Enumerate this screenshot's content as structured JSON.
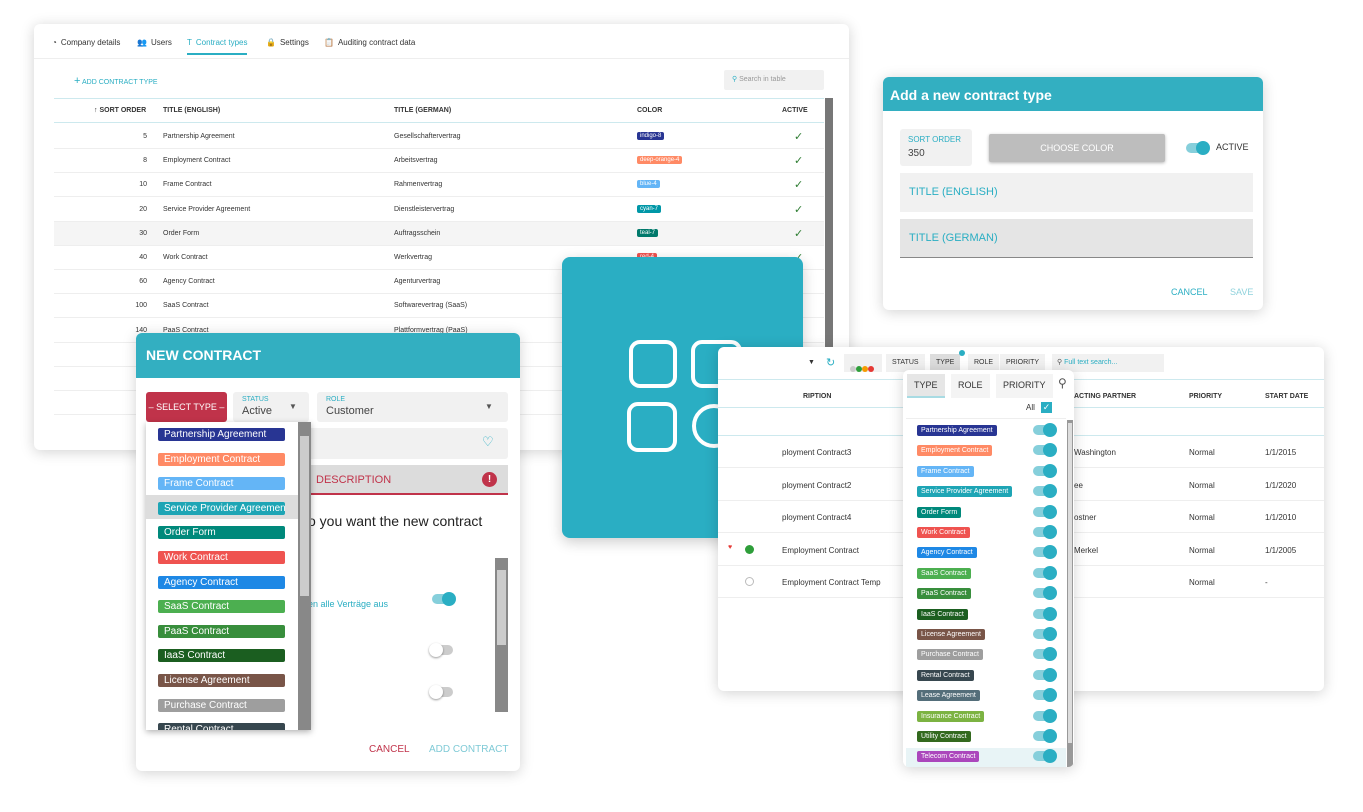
{
  "settings": {
    "tabs": [
      {
        "label": "Company details",
        "icon": "building-icon"
      },
      {
        "label": "Users",
        "icon": "users-icon"
      },
      {
        "label": "Contract types",
        "icon": "text-icon",
        "active": true
      },
      {
        "label": "Settings",
        "icon": "lock-icon"
      },
      {
        "label": "Auditing contract data",
        "icon": "clipboard-icon"
      }
    ],
    "add_label": "ADD CONTRACT TYPE",
    "search_placeholder": "Search in table",
    "columns": [
      "SORT ORDER",
      "TITLE (ENGLISH)",
      "TITLE (GERMAN)",
      "COLOR",
      "ACTIVE"
    ],
    "rows": [
      {
        "order": "5",
        "en": "Partnership Agreement",
        "de": "Gesellschaftervertrag",
        "color": "indigo-8",
        "hex": "#283593",
        "active": true
      },
      {
        "order": "8",
        "en": "Employment Contract",
        "de": "Arbeitsvertrag",
        "color": "deep-orange-4",
        "hex": "#ff8a65",
        "active": true
      },
      {
        "order": "10",
        "en": "Frame Contract",
        "de": "Rahmenvertrag",
        "color": "blue-4",
        "hex": "#64b5f6",
        "active": true
      },
      {
        "order": "20",
        "en": "Service Provider Agreement",
        "de": "Dienstleistervertrag",
        "color": "cyan-7",
        "hex": "#0097a7",
        "active": true
      },
      {
        "order": "30",
        "en": "Order Form",
        "de": "Auftragsschein",
        "color": "teal-7",
        "hex": "#00796b",
        "active": true
      },
      {
        "order": "40",
        "en": "Work Contract",
        "de": "Werkvertrag",
        "color": "red-4",
        "hex": "#ef5350",
        "active": true
      },
      {
        "order": "60",
        "en": "Agency Contract",
        "de": "Agenturvertrag",
        "color": "",
        "hex": "",
        "active": false
      },
      {
        "order": "100",
        "en": "SaaS Contract",
        "de": "Softwarevertrag (SaaS)",
        "color": "",
        "hex": "",
        "active": false
      },
      {
        "order": "140",
        "en": "PaaS Contract",
        "de": "Plattformvertrag (PaaS)",
        "color": "",
        "hex": "",
        "active": false
      }
    ]
  },
  "new_contract": {
    "title": "NEW CONTRACT",
    "select_type": "– SELECT TYPE –",
    "status_label": "STATUS",
    "status_value": "Active",
    "role_label": "ROLE",
    "role_value": "Customer",
    "description_label": "DESCRIPTION",
    "question": "o you want the new contract",
    "toggle_label": "en alle Verträge aus",
    "cancel": "CANCEL",
    "add": "ADD CONTRACT"
  },
  "types": [
    {
      "name": "Partnership Agreement",
      "hex": "#283593"
    },
    {
      "name": "Employment Contract",
      "hex": "#ff8a65"
    },
    {
      "name": "Frame Contract",
      "hex": "#64b5f6"
    },
    {
      "name": "Service Provider Agreement",
      "hex": "#1ea5b5"
    },
    {
      "name": "Order Form",
      "hex": "#00897b"
    },
    {
      "name": "Work Contract",
      "hex": "#ef5350"
    },
    {
      "name": "Agency Contract",
      "hex": "#1e88e5"
    },
    {
      "name": "SaaS Contract",
      "hex": "#4caf50"
    },
    {
      "name": "PaaS Contract",
      "hex": "#388e3c"
    },
    {
      "name": "IaaS Contract",
      "hex": "#1b5e20"
    },
    {
      "name": "License Agreement",
      "hex": "#795548"
    },
    {
      "name": "Purchase Contract",
      "hex": "#9e9e9e"
    },
    {
      "name": "Rental Contract",
      "hex": "#37474f"
    },
    {
      "name": "Lease Agreement",
      "hex": "#546e7a"
    },
    {
      "name": "Insurance Contract",
      "hex": "#7cb342"
    },
    {
      "name": "Utility Contract",
      "hex": "#33691e"
    },
    {
      "name": "Telecom Contract",
      "hex": "#ab47bc"
    }
  ],
  "add_type": {
    "title": "Add a new contract type",
    "sort_label": "SORT ORDER",
    "sort_value": "350",
    "choose_color": "CHOOSE COLOR",
    "active_label": "ACTIVE",
    "title_en": "TITLE (ENGLISH)",
    "title_de": "TITLE (GERMAN)",
    "cancel": "CANCEL",
    "save": "SAVE"
  },
  "contracts": {
    "filters": [
      "STATUS",
      "TYPE",
      "ROLE",
      "PRIORITY"
    ],
    "search_placeholder": "Full text search...",
    "columns": [
      "RIPTION",
      "ACTING PARTNER",
      "PRIORITY",
      "START DATE"
    ],
    "rows": [
      {
        "desc": "ployment Contract3",
        "partner": "Washington",
        "priority": "Normal",
        "start": "1/1/2015"
      },
      {
        "desc": "ployment Contract2",
        "partner": "ee",
        "priority": "Normal",
        "start": "1/1/2020"
      },
      {
        "desc": "ployment Contract4",
        "partner": "ostner",
        "priority": "Normal",
        "start": "1/1/2010"
      },
      {
        "desc": "Employment Contract",
        "partner": "Merkel",
        "priority": "Normal",
        "start": "1/1/2005"
      },
      {
        "desc": "Employment Contract Temp",
        "partner": "",
        "priority": "Normal",
        "start": "-"
      }
    ]
  },
  "type_filter": {
    "tabs": [
      "TYPE",
      "ROLE",
      "PRIORITY"
    ],
    "all_label": "All"
  },
  "accent": "#2aaec3"
}
